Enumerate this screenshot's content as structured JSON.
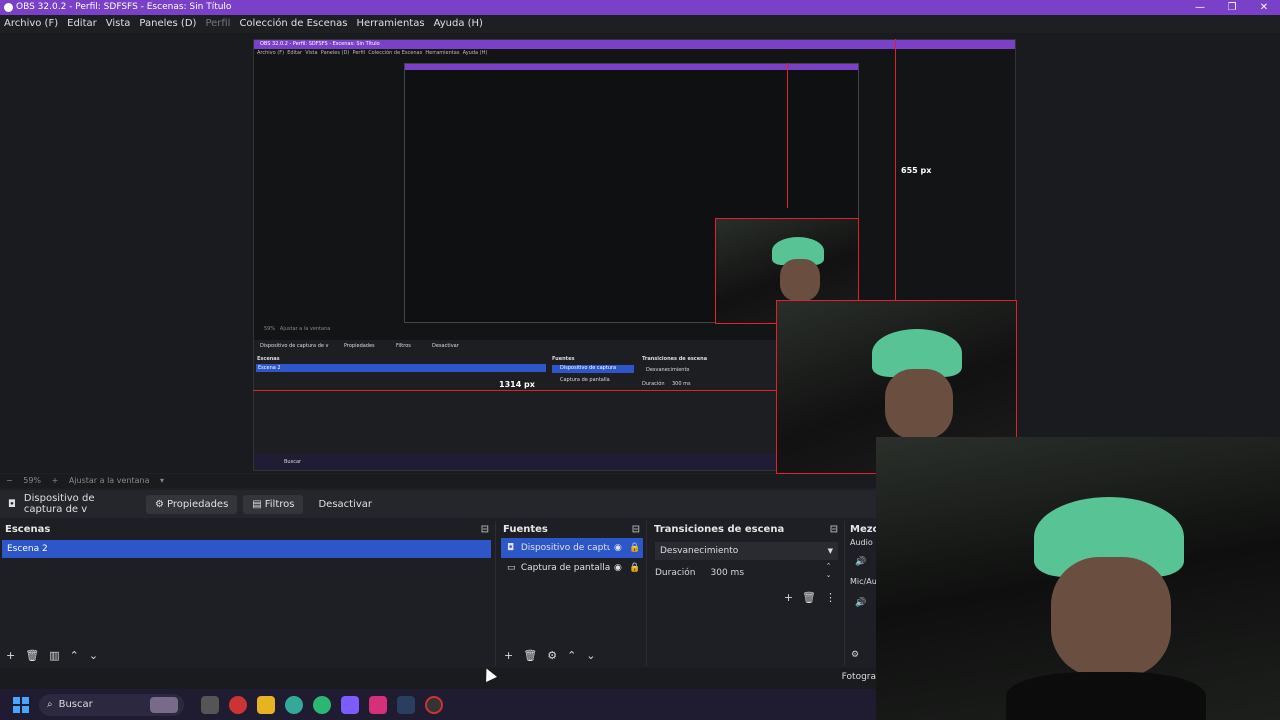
{
  "window": {
    "title": "OBS 32.0.2 - Perfil: SDFSFS - Escenas: Sin Título",
    "controls": [
      "—",
      "❐",
      "✕"
    ]
  },
  "menu": {
    "items": [
      "Archivo (F)",
      "Editar",
      "Vista",
      "Paneles (D)",
      "Perfil",
      "Colección de Escenas",
      "Herramientas",
      "Ayuda (H)"
    ]
  },
  "preview": {
    "nested_title": "OBS 32.0.2 - Perfil: SDFSFS - Escenas: Sin Título",
    "nested_menu": [
      "Archivo (F)",
      "Editar",
      "Vista",
      "Paneles (D)",
      "Perfil",
      "Colección de Escenas",
      "Herramientas",
      "Ayuda (H)"
    ],
    "measure_height": "655 px",
    "measure_width": "1314 px",
    "nested_source_label": "Dispositivo de captura de v",
    "nested_props": "Propiedades",
    "nested_filters": "Filtros",
    "nested_deactivate": "Desactivar",
    "nested_scenes": "Escenas",
    "nested_scene_item": "Escena 2",
    "nested_sources": "Fuentes",
    "nested_src1": "Dispositivo de captura",
    "nested_src2": "Captura de pantalla",
    "nested_transitions": "Transiciones de escena",
    "nested_fade": "Desvanecimiento",
    "nested_duration": "Duración",
    "nested_duration_val": "300 ms",
    "nested_zoom": "59%",
    "nested_fit": "Ajustar a la ventana",
    "nested_search": "Buscar"
  },
  "status": {
    "zoom": "59%",
    "fit": "Ajustar a la ventana"
  },
  "sourcebar": {
    "source": "Dispositivo de captura de v",
    "properties": "Propiedades",
    "filters": "Filtros",
    "deactivate": "Desactivar"
  },
  "scenes": {
    "title": "Escenas",
    "items": [
      "Escena 2"
    ]
  },
  "sources": {
    "title": "Fuentes",
    "items": [
      {
        "name": "Dispositivo de captura",
        "selected": true
      },
      {
        "name": "Captura de pantalla",
        "selected": false
      }
    ]
  },
  "transitions": {
    "title": "Transiciones de escena",
    "type": "Desvanecimiento",
    "duration_label": "Duración",
    "duration_value": "300 ms"
  },
  "mixer": {
    "title": "Mezcl",
    "ch1": "Audio",
    "ch2": "Mic/Au"
  },
  "bottom": {
    "foto": "Fotogra"
  },
  "taskbar": {
    "search": "Buscar"
  },
  "colors": {
    "accent": "#7a41c8",
    "selection": "#2d56c8",
    "measure_line": "#e0202a",
    "cap": "#58c394"
  }
}
